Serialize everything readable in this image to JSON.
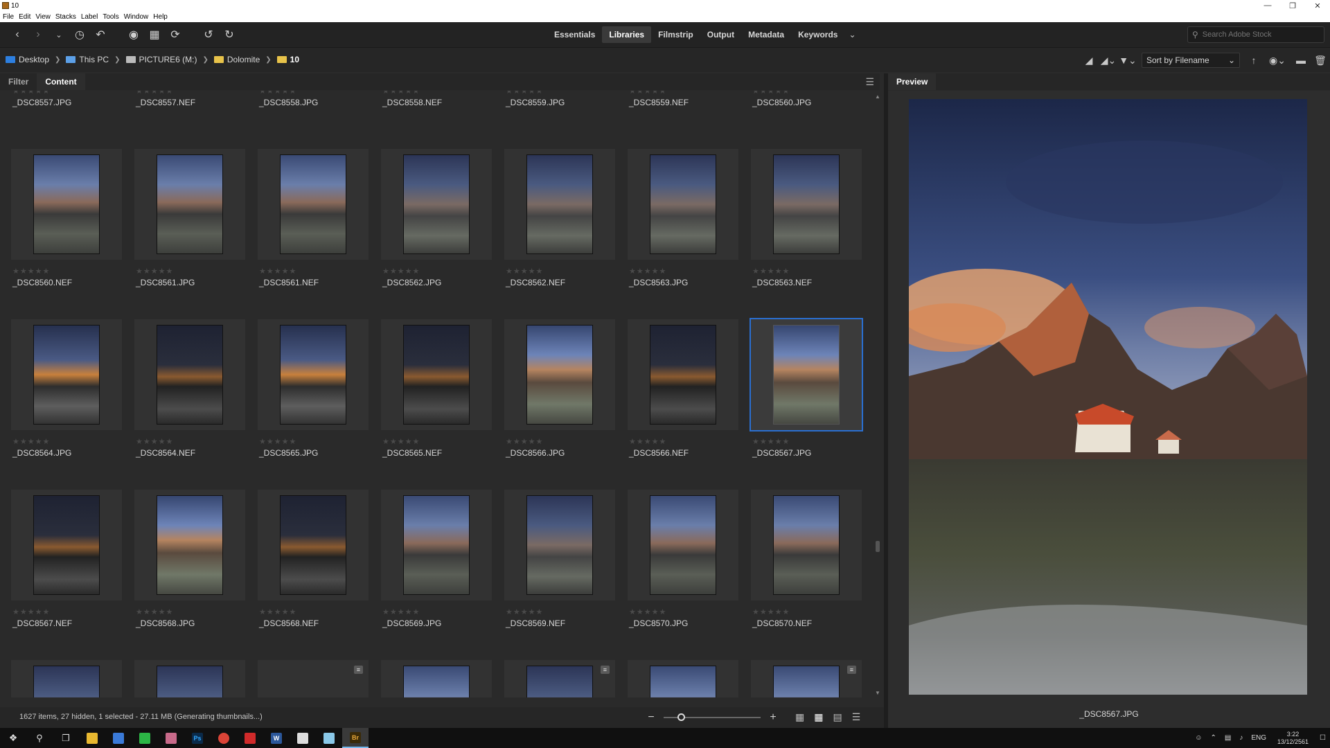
{
  "window": {
    "title": "10"
  },
  "menu": [
    "File",
    "Edit",
    "View",
    "Stacks",
    "Label",
    "Tools",
    "Window",
    "Help"
  ],
  "workspaces": [
    {
      "label": "Essentials",
      "active": false
    },
    {
      "label": "Libraries",
      "active": true
    },
    {
      "label": "Filmstrip",
      "active": false
    },
    {
      "label": "Output",
      "active": false
    },
    {
      "label": "Metadata",
      "active": false
    },
    {
      "label": "Keywords",
      "active": false
    }
  ],
  "search": {
    "placeholder": "Search Adobe Stock"
  },
  "breadcrumb": [
    {
      "label": "Desktop",
      "icon": "desktop-folder-icon",
      "color": "#2d7fe0"
    },
    {
      "label": "This PC",
      "icon": "pc-icon",
      "color": "#5ca0e8"
    },
    {
      "label": "PICTURE6 (M:)",
      "icon": "drive-icon",
      "color": "#bbbbbb"
    },
    {
      "label": "Dolomite",
      "icon": "folder-icon",
      "color": "#e8c34a"
    },
    {
      "label": "10",
      "icon": "folder-icon",
      "color": "#e8c34a"
    }
  ],
  "sort": {
    "label": "Sort by Filename"
  },
  "panel_tabs": [
    {
      "label": "Filter",
      "active": false
    },
    {
      "label": "Content",
      "active": true
    }
  ],
  "top_row_partial": [
    "_DSC8557.JPG",
    "_DSC8557.NEF",
    "_DSC8558.JPG",
    "_DSC8558.NEF",
    "_DSC8559.JPG",
    "_DSC8559.NEF",
    "_DSC8560.JPG"
  ],
  "rows": [
    [
      {
        "name": "_DSC8560.NEF",
        "tone": "t1"
      },
      {
        "name": "_DSC8561.JPG",
        "tone": "t1"
      },
      {
        "name": "_DSC8561.NEF",
        "tone": "t1"
      },
      {
        "name": "_DSC8562.JPG",
        "tone": "t2"
      },
      {
        "name": "_DSC8562.NEF",
        "tone": "t2"
      },
      {
        "name": "_DSC8563.JPG",
        "tone": "t2"
      },
      {
        "name": "_DSC8563.NEF",
        "tone": "t2"
      }
    ],
    [
      {
        "name": "_DSC8564.JPG",
        "tone": "t3"
      },
      {
        "name": "_DSC8564.NEF",
        "tone": "t4"
      },
      {
        "name": "_DSC8565.JPG",
        "tone": "t3"
      },
      {
        "name": "_DSC8565.NEF",
        "tone": "t4"
      },
      {
        "name": "_DSC8566.JPG",
        "tone": "t5"
      },
      {
        "name": "_DSC8566.NEF",
        "tone": "t4"
      },
      {
        "name": "_DSC8567.JPG",
        "tone": "t5",
        "selected": true
      }
    ],
    [
      {
        "name": "_DSC8567.NEF",
        "tone": "t4"
      },
      {
        "name": "_DSC8568.JPG",
        "tone": "t5"
      },
      {
        "name": "_DSC8568.NEF",
        "tone": "t4"
      },
      {
        "name": "_DSC8569.JPG",
        "tone": "t1"
      },
      {
        "name": "_DSC8569.NEF",
        "tone": "t2"
      },
      {
        "name": "_DSC8570.JPG",
        "tone": "t1"
      },
      {
        "name": "_DSC8570.NEF",
        "tone": "t1"
      }
    ]
  ],
  "stars_glyph": "★★★★★",
  "preview": {
    "title": "Preview",
    "filename": "_DSC8567.JPG"
  },
  "status": {
    "text": "1627 items, 27 hidden, 1 selected - 27.11 MB (Generating thumbnails...)"
  },
  "zoom": {
    "level": 0.15
  },
  "clock": {
    "time": "3:22",
    "date": "13/12/2561"
  },
  "taskbar_lang": "ENG",
  "accent": "#2a6fd1"
}
